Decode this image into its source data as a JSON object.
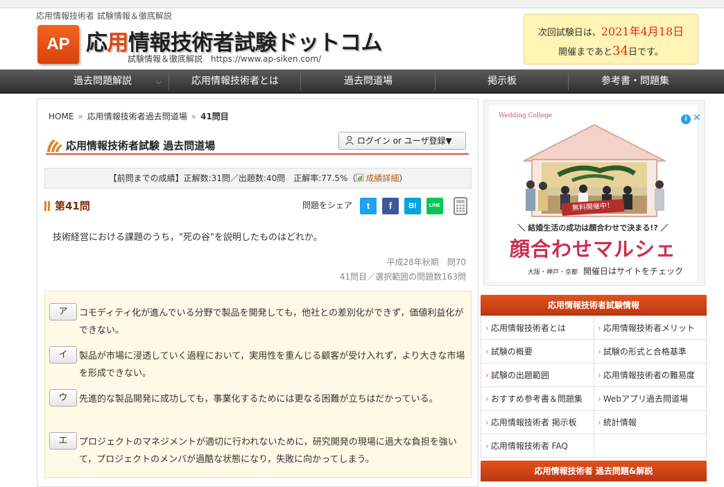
{
  "header": {
    "tagline": "応用情報技術者 試験情報＆徹底解説",
    "logo_text": "AP",
    "title_pre": "応",
    "title_hl": "用",
    "title_post": "情報技術者試験ドットコム",
    "subtitle": "試験情報＆徹底解説　https://www.ap-siken.com/",
    "exam_line1_pre": "次回試験日は、",
    "exam_date": "2021年4月18日",
    "exam_line2_pre": "開催まであと",
    "exam_days": "34",
    "exam_line2_post": "日です。"
  },
  "nav": {
    "items": [
      "過去問題解説",
      "応用情報技術者とは",
      "過去問道場",
      "掲示板",
      "参考書・問題集"
    ],
    "dropdown_glyph": "⌵"
  },
  "breadcrumb": {
    "home": "HOME",
    "sep": "»",
    "parent": "応用情報技術者過去問道場",
    "current": "41問目"
  },
  "section": {
    "title": "応用情報技術者試験 過去問道場",
    "login_label": "ログイン or ユーザ登録▼"
  },
  "score": {
    "text": "【前問までの成績】正解数:31問／出題数:40問　正解率:77.5%（",
    "link": "成績詳細",
    "close": "）"
  },
  "question": {
    "number_label": "第41問",
    "share_label": "問題をシェア",
    "share_buttons": [
      "twitter",
      "facebook",
      "hatena",
      "line"
    ],
    "share_glyphs": [
      "t",
      "f",
      "B!",
      "LINE"
    ],
    "text": "技術経営における課題のうち，\"死の谷\"を説明したものはどれか。",
    "source": "平成28年秋期　問70",
    "position": "41問目／選択範囲の問題数163問",
    "choices": [
      {
        "label": "ア",
        "text": "コモディティ化が進んでいる分野で製品を開発しても，他社との差別化ができず，価値利益化ができない。"
      },
      {
        "label": "イ",
        "text": "製品が市場に浸透していく過程において，実用性を重んじる顧客が受け入れず，より大きな市場を形成できない。"
      },
      {
        "label": "ウ",
        "text": "先進的な製品開発に成功しても，事業化するためには更なる困難が立ちはだかっている。"
      },
      {
        "label": "エ",
        "text": "プロジェクトのマネジメントが適切に行われないために，研究開発の現場に過大な負担を強いて，プロジェクトのメンバが過酷な状態になり，失敗に向かってしまう。"
      }
    ]
  },
  "ad": {
    "brand": "Wedding College",
    "badge": "i",
    "close": "✕",
    "free_label": "無料開催中！",
    "copy": "＼ 結婚生活の成功は顔合わせで決まる!? ／",
    "headline": "顔合わせマルシェ",
    "footer_cities": "大阪・神戸・京都",
    "footer_text": "開催日はサイトをチェック"
  },
  "sidebar": {
    "info_title": "応用情報技術者試験情報",
    "links_left": [
      "応用情報技術者とは",
      "試験の概要",
      "試験の出題範囲",
      "おすすめ参考書＆問題集",
      "応用情報技術者 掲示板",
      "応用情報技術者 FAQ"
    ],
    "links_right": [
      "応用情報技術者メリット",
      "試験の形式と合格基準",
      "応用情報技術者の難易度",
      "Webアプリ過去問道場",
      "統計情報"
    ],
    "past_title": "応用情報技術者 過去問題&解説"
  },
  "colors": {
    "accent": "#e0842c",
    "brand_red": "#d8543a",
    "nav_bg": "#3a3a3a",
    "choice_bg": "#fff9e6",
    "exam_box": "#fff4b4",
    "sidebar_head": "#d9461a"
  }
}
